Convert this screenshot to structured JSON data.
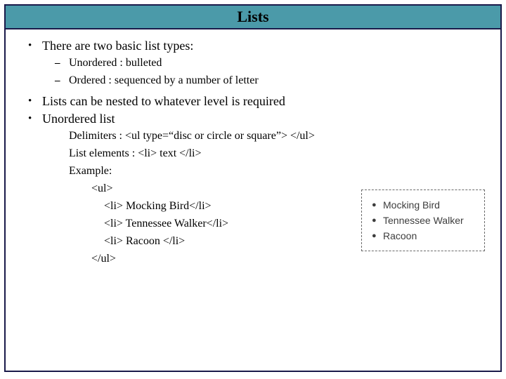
{
  "title": "Lists",
  "b1": "There are two basic list types:",
  "b1a": "Unordered : bulleted",
  "b1b": "Ordered : sequenced by a number of letter",
  "b2": "Lists can be nested to whatever level is required",
  "b3": "Unordered list",
  "c1": "Delimiters : <ul type=“disc or circle or square”>  </ul>",
  "c2": "List elements : <li> text </li>",
  "c3": "Example:",
  "c4": "<ul>",
  "c5": "<li> Mocking Bird</li>",
  "c6": "<li> Tennessee Walker</li>",
  "c7": "<li> Racoon </li>",
  "c8": "</ul>",
  "ex1": "Mocking Bird",
  "ex2": "Tennessee Walker",
  "ex3": "Racoon"
}
